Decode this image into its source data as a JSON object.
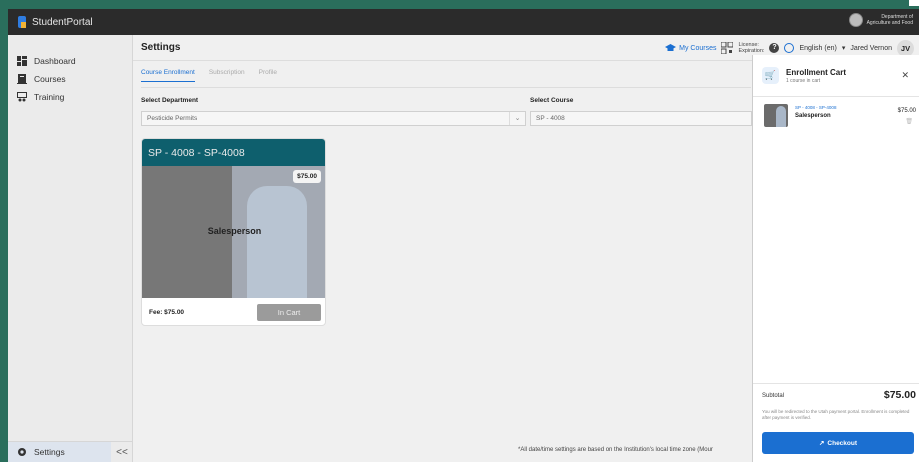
{
  "app": {
    "title": "StudentPortal",
    "dept_line1": "Department of",
    "dept_line2": "Agriculture and Food"
  },
  "sidebar": {
    "items": [
      {
        "label": "Dashboard",
        "icon": "dashboard-icon"
      },
      {
        "label": "Courses",
        "icon": "book-icon"
      },
      {
        "label": "Training",
        "icon": "training-icon"
      }
    ],
    "settings_label": "Settings",
    "collapse_glyph": "<<"
  },
  "header": {
    "title": "Settings",
    "my_courses": "My Courses",
    "license_label": "License:",
    "expiration_label": "Expiration:",
    "language": "English (en)",
    "user_name": "Jared Vernon",
    "user_initials": "JV"
  },
  "tabs": [
    {
      "label": "Course Enrollment",
      "active": true
    },
    {
      "label": "Subscription",
      "active": false
    },
    {
      "label": "Profile",
      "active": false
    }
  ],
  "form": {
    "department_label": "Select Department",
    "department_value": "Pesticide Permits",
    "course_label": "Select Course",
    "course_value": "SP - 4008"
  },
  "course_card": {
    "title": "SP - 4008 - SP-4008",
    "price_badge": "$75.00",
    "caption": "Salesperson",
    "fee": "Fee: $75.00",
    "button": "In Cart"
  },
  "footer_note": "*All date/time settings are based on the Institution's local time zone (Mour",
  "cart": {
    "title": "Enrollment Cart",
    "subtitle": "1 course in cart",
    "item_code": "SP - 4008 - SP-4008",
    "item_name": "Salesperson",
    "item_price": "$75.00",
    "subtotal_label": "Subtotal",
    "subtotal_value": "$75.00",
    "note": "You will be redirected to the Utah payment portal. Enrollment is completed after payment is verified.",
    "checkout_label": "Checkout"
  },
  "colors": {
    "accent": "#1b6fd1",
    "card_header": "#0e5f6d",
    "topbar": "#2b2b2b",
    "background": "#2a6e5c"
  }
}
